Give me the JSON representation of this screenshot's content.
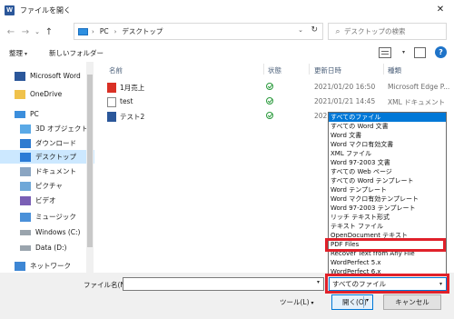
{
  "window": {
    "title": "ファイルを開く",
    "app_icon": "W",
    "close_glyph": "✕"
  },
  "nav": {
    "path": [
      "PC",
      "デスクトップ"
    ],
    "search_placeholder": "デスクトップの検索"
  },
  "toolbar": {
    "organize": "整理",
    "new_folder": "新しいフォルダー",
    "help": "?"
  },
  "sidebar": {
    "items": [
      {
        "label": "Microsoft Word",
        "icon": "word-icon"
      },
      {
        "label": "OneDrive",
        "icon": "folder-icon"
      },
      {
        "label": "PC",
        "icon": "pc-icon"
      },
      {
        "label": "3D オブジェクト",
        "icon": "3d-objects-icon"
      },
      {
        "label": "ダウンロード",
        "icon": "download-icon"
      },
      {
        "label": "デスクトップ",
        "icon": "desktop-icon"
      },
      {
        "label": "ドキュメント",
        "icon": "documents-icon"
      },
      {
        "label": "ピクチャ",
        "icon": "pictures-icon"
      },
      {
        "label": "ビデオ",
        "icon": "videos-icon"
      },
      {
        "label": "ミュージック",
        "icon": "music-icon"
      },
      {
        "label": "Windows (C:)",
        "icon": "drive-icon"
      },
      {
        "label": "Data (D:)",
        "icon": "drive-icon"
      },
      {
        "label": "ネットワーク",
        "icon": "network-icon"
      }
    ]
  },
  "columns": {
    "name": "名前",
    "status": "状態",
    "modified": "更新日時",
    "type": "種類"
  },
  "files": [
    {
      "name": "1月売上",
      "date": "2021/01/20 16:50",
      "type": "Microsoft Edge P...",
      "icon": "pdf-file-icon"
    },
    {
      "name": "test",
      "date": "2021/01/21 14:45",
      "type": "XML ドキュメント",
      "icon": "xml-file-icon"
    },
    {
      "name": "テスト2",
      "date": "2021/01/2",
      "type": "",
      "icon": "word-file-icon"
    }
  ],
  "filter_options": [
    "すべてのファイル",
    "すべての Word 文書",
    "Word 文書",
    "Word マクロ有効文書",
    "XML ファイル",
    "Word 97-2003 文書",
    "すべての Web ページ",
    "すべての Word テンプレート",
    "Word テンプレート",
    "Word マクロ有効テンプレート",
    "Word 97-2003 テンプレート",
    "リッチ テキスト形式",
    "テキスト ファイル",
    "OpenDocument テキスト",
    "PDF Files",
    "Recover Text from Any File",
    "WordPerfect 5.x",
    "WordPerfect 6.x"
  ],
  "bottom": {
    "filename_label": "ファイル名(N):",
    "filter_value": "すべてのファイル",
    "tools": "ツール(L)",
    "open": "開く(O)",
    "cancel": "キャンセル"
  },
  "colors": {
    "accent": "#0078d7",
    "highlight": "#e0212a",
    "selection": "#cce8ff"
  }
}
